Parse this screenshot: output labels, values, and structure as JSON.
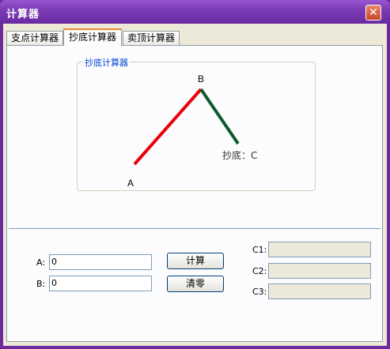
{
  "window": {
    "title": "计算器",
    "close_label": "✕"
  },
  "tabs": [
    {
      "label": "支点计算器",
      "active": false
    },
    {
      "label": "抄底计算器",
      "active": true
    },
    {
      "label": "卖顶计算器",
      "active": false
    }
  ],
  "group": {
    "title": "抄底计算器",
    "diagram": {
      "point_a": "A",
      "point_b": "B",
      "point_c": "抄底：C"
    }
  },
  "inputs": {
    "a": {
      "label": "A:",
      "value": "0"
    },
    "b": {
      "label": "B:",
      "value": "0"
    }
  },
  "buttons": {
    "calc": "计算",
    "clear": "清零"
  },
  "outputs": {
    "c1": {
      "label": "C1:",
      "value": ""
    },
    "c2": {
      "label": "C2:",
      "value": ""
    },
    "c3": {
      "label": "C3:",
      "value": ""
    }
  },
  "colors": {
    "up_line": "#e8000b",
    "down_line": "#0c5a2e",
    "title_bar": "#6d2a9d"
  }
}
